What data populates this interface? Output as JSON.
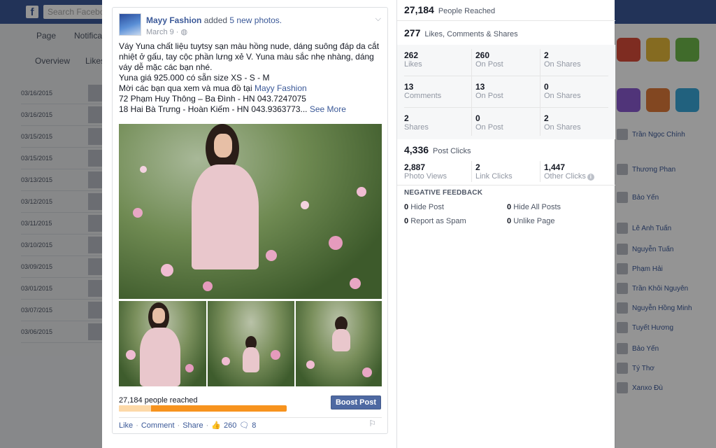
{
  "background": {
    "search_placeholder": "Search Facebook",
    "tabs": [
      "Page",
      "Notifications"
    ],
    "subtabs": [
      "Overview",
      "Likes"
    ],
    "dates": [
      "03/16/2015",
      "03/16/2015",
      "03/15/2015",
      "03/15/2015",
      "03/13/2015",
      "03/12/2015",
      "03/11/2015",
      "03/10/2015",
      "03/09/2015",
      "03/01/2015",
      "03/07/2015",
      "03/06/2015"
    ],
    "friends": [
      "Trần Ngọc Chính",
      "Thương Phan",
      "Bảo Yến",
      "Lê Anh Tuấn",
      "Nguyễn Tuấn",
      "Phạm Hải",
      "Trần Khôi Nguyên",
      "Nguyễn Hồng Minh",
      "Tuyết Hương",
      "Bảo Yến",
      "Tý Thơ",
      "Xanxo Đù"
    ]
  },
  "post": {
    "author": "Mayy Fashion",
    "action": "added",
    "action_link": "5 new photos.",
    "date": "March 9 · ",
    "lines": [
      "Váy Yuna chất liệu tuytsy sạn màu hồng nude, dáng suông đáp da cắt nhiệt ở gấu, tay cộc phần lưng xẻ V. Yuna màu sắc nhẹ nhàng, dáng váy dễ mặc các bạn nhé.",
      "Yuna giá 925.000 có sẵn size XS - S - M"
    ],
    "line_shop_prefix": "Mời các bạn qua xem và mua đồ tại ",
    "line_shop_link": "Mayy Fashion",
    "line_addr1": "72 Phạm Huy Thông – Ba Đình - HN 043.7247075",
    "line_addr2": "18 Hai Bà Trưng - Hoàn Kiếm - HN 043.9363773...",
    "see_more": "See More",
    "reach_text": "27,184 people reached",
    "reach_organic_fraction": 0.19,
    "boost_label": "Boost Post",
    "like": "Like",
    "comment": "Comment",
    "share": "Share",
    "like_count": "260",
    "comment_count": "8",
    "accent": "#3b5998",
    "reach_color": "#f7931e"
  },
  "insights": {
    "reached_num": "27,184",
    "reached_label": "People Reached",
    "engage_num": "277",
    "engage_label": "Likes, Comments & Shares",
    "rows": [
      [
        {
          "n": "262",
          "l": "Likes"
        },
        {
          "n": "260",
          "l": "On Post"
        },
        {
          "n": "2",
          "l": "On Shares"
        }
      ],
      [
        {
          "n": "13",
          "l": "Comments"
        },
        {
          "n": "13",
          "l": "On Post"
        },
        {
          "n": "0",
          "l": "On Shares"
        }
      ],
      [
        {
          "n": "2",
          "l": "Shares"
        },
        {
          "n": "0",
          "l": "On Post"
        },
        {
          "n": "2",
          "l": "On Shares"
        }
      ]
    ],
    "clicks_num": "4,336",
    "clicks_label": "Post Clicks",
    "clicks": [
      {
        "n": "2,887",
        "l": "Photo Views"
      },
      {
        "n": "2",
        "l": "Link Clicks"
      },
      {
        "n": "1,447",
        "l": "Other Clicks"
      }
    ],
    "neg_title": "NEGATIVE FEEDBACK",
    "neg": [
      {
        "n": "0",
        "l": "Hide Post"
      },
      {
        "n": "0",
        "l": "Hide All Posts"
      },
      {
        "n": "0",
        "l": "Report as Spam"
      },
      {
        "n": "0",
        "l": "Unlike Page"
      }
    ]
  }
}
